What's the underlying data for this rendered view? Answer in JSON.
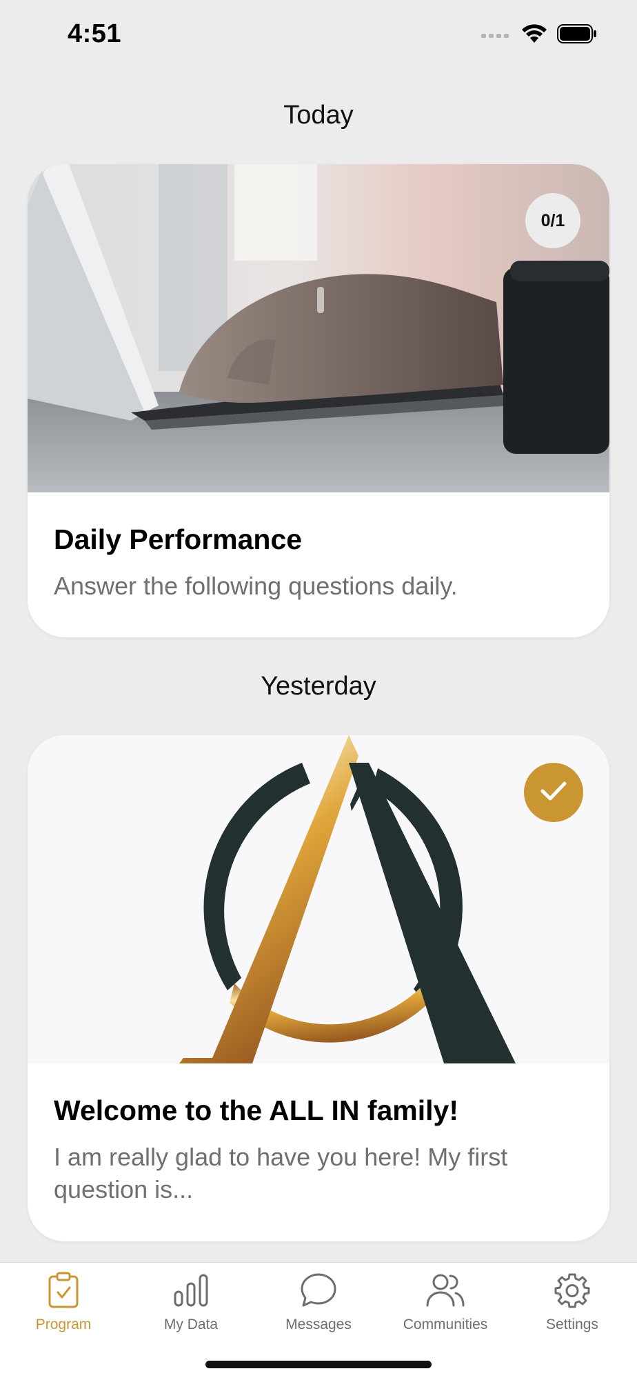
{
  "status_bar": {
    "time": "4:51",
    "icons": [
      "signal-icon",
      "wifi-icon",
      "battery-icon"
    ]
  },
  "sections": {
    "today": "Today",
    "yesterday": "Yesterday"
  },
  "cards": [
    {
      "title": "Daily Performance",
      "description": "Answer the following questions daily.",
      "image": "laptop-typing-photo",
      "badge": "0/1"
    },
    {
      "title": "Welcome to the ALL IN family!",
      "description": "I am really glad to have you here! My first question is...",
      "image": "all-in-logo",
      "badge_icon": "checkmark-icon"
    }
  ],
  "tab_bar": {
    "tabs": [
      {
        "label": "Program",
        "icon": "clipboard-check-icon",
        "active": true
      },
      {
        "label": "My Data",
        "icon": "bar-chart-icon",
        "active": false
      },
      {
        "label": "Messages",
        "icon": "chat-bubble-icon",
        "active": false
      },
      {
        "label": "Communities",
        "icon": "people-icon",
        "active": false
      },
      {
        "label": "Settings",
        "icon": "gear-icon",
        "active": false
      }
    ]
  },
  "colors": {
    "accent": "#c99632",
    "background": "#ececec",
    "inactive": "#6d6d6d",
    "logo_dark": "#22302f"
  }
}
